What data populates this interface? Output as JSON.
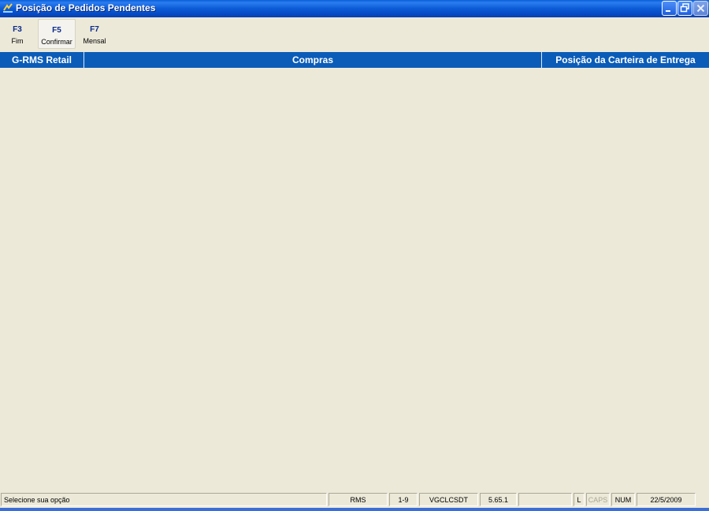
{
  "window": {
    "title": "Posição de Pedidos Pendentes",
    "icon": "rms-app-icon",
    "buttons": [
      "minimize",
      "restore",
      "close"
    ]
  },
  "toolbar": {
    "fkeys": [
      {
        "key": "F3",
        "label": "Fim",
        "active": false
      },
      {
        "key": "F5",
        "label": "Confirmar",
        "active": true
      },
      {
        "key": "F7",
        "label": "Mensal",
        "active": false
      }
    ]
  },
  "header": {
    "system": "G-RMS Retail",
    "module": "Compras",
    "screen": "Posição da Carteira de Entrega"
  },
  "statusbar": {
    "message": "Selecione sua opção",
    "company": "RMS",
    "range": "1-9",
    "program": "VGCLCSDT",
    "version": "5.65.1",
    "empty": "",
    "lock": "L",
    "caps": "CAPS",
    "num": "NUM",
    "date": "22/5/2009"
  },
  "colors": {
    "titlebar": "#0a5fd8",
    "header": "#0b5cb8",
    "background": "#ece9d8",
    "fkey_text": "#0a2a8a"
  }
}
